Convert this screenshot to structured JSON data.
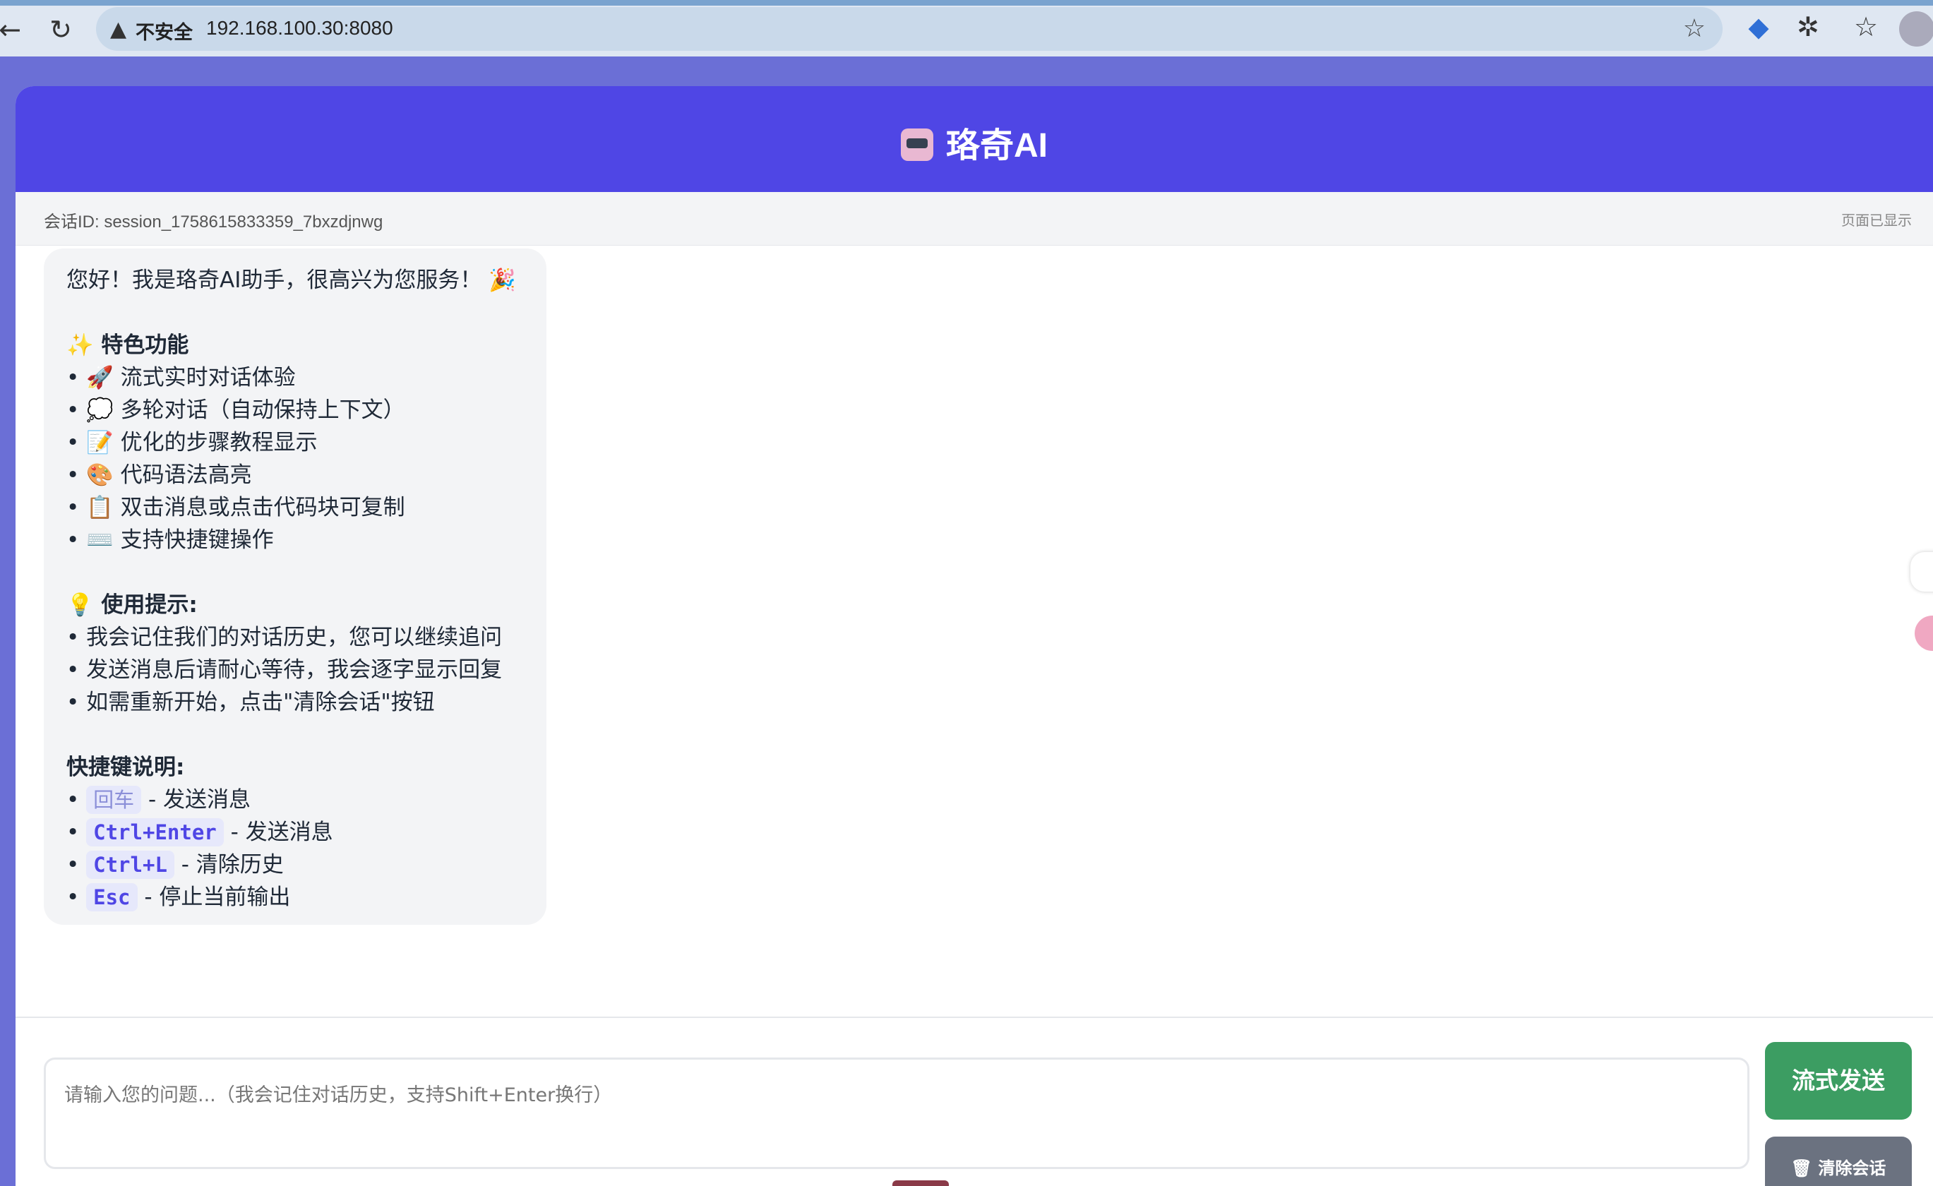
{
  "browser": {
    "insecure_label": "不安全",
    "url": "192.168.100.30:8080"
  },
  "header": {
    "title": "珞奇AI"
  },
  "session": {
    "id_text": "会话ID: session_1758615833359_7bxzdjnwg",
    "status": "页面已显示"
  },
  "message": {
    "greeting": "您好！我是珞奇AI助手，很高兴为您服务！ 🎉",
    "features_title": "✨ 特色功能",
    "features": [
      "• 🚀 流式实时对话体验",
      "• 💭 多轮对话（自动保持上下文）",
      "• 📝 优化的步骤教程显示",
      "• 🎨 代码语法高亮",
      "• 📋 双击消息或点击代码块可复制",
      "• ⌨️ 支持快捷键操作"
    ],
    "tips_title": "💡 使用提示:",
    "tips": [
      "• 我会记住我们的对话历史，您可以继续追问",
      "• 发送消息后请耐心等待，我会逐字显示回复",
      "• 如需重新开始，点击\"清除会话\"按钮"
    ],
    "shortcuts_title": "快捷键说明:",
    "shortcuts": [
      {
        "key": "回车",
        "desc": " - 发送消息"
      },
      {
        "key": "Ctrl+Enter",
        "desc": " - 发送消息"
      },
      {
        "key": "Ctrl+L",
        "desc": " - 清除历史"
      },
      {
        "key": "Esc",
        "desc": " - 停止当前输出"
      }
    ]
  },
  "input": {
    "placeholder": "请输入您的问题...（我会记住对话历史，支持Shift+Enter换行）"
  },
  "buttons": {
    "send": "流式发送",
    "clear": "清除会话"
  }
}
